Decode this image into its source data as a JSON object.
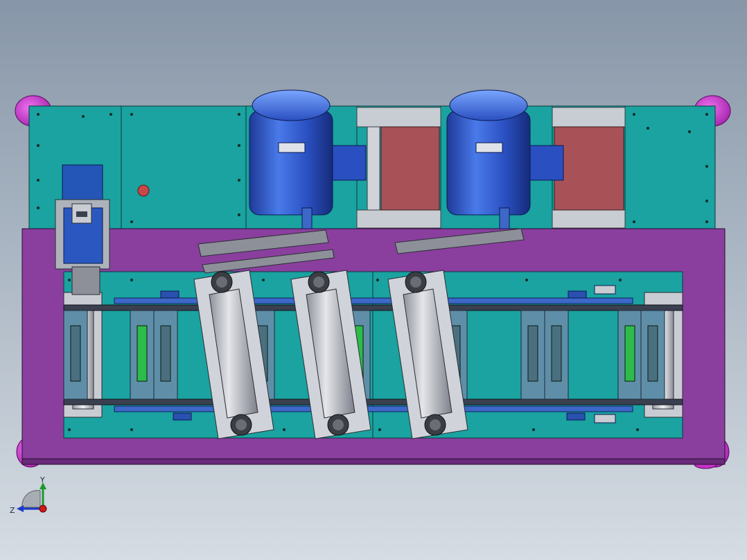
{
  "viewport": {
    "background_top": "#8796a8",
    "background_bottom": "#d6dce3"
  },
  "colors": {
    "teal_panel": "#1aa3a0",
    "purple_base": "#8a3f9e",
    "magenta_feet": "#c532c8",
    "motor_blue": "#2a52c8",
    "red_panel": "#a85258",
    "chain_dark": "#3a4050",
    "cylinder_gray": "#b9bcc4",
    "green_part": "#2dbb4a",
    "rail_blue": "#3d68c8"
  },
  "icons": {
    "triad": "view-orientation-triad-icon"
  },
  "triad": {
    "y_label": "Y",
    "z_label": "Z"
  }
}
